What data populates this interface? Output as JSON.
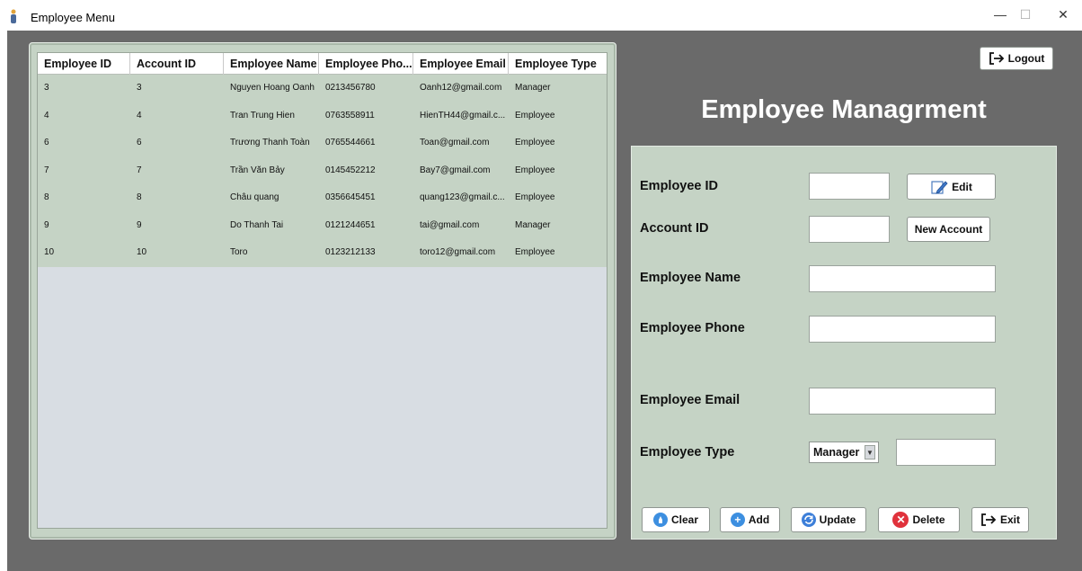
{
  "window": {
    "title": "Employee Menu",
    "minimize": "—",
    "maximize": "☐",
    "close": "✕"
  },
  "table": {
    "headers": [
      "Employee ID",
      "Account ID",
      "Employee Name",
      "Employee Pho...",
      "Employee Email",
      "Employee Type"
    ],
    "rows": [
      [
        "3",
        "3",
        "Nguyen Hoang Oanh",
        "0213456780",
        "Oanh12@gmail.com",
        "Manager"
      ],
      [
        "4",
        "4",
        "Tran Trung Hien",
        "0763558911",
        "HienTH44@gmail.c...",
        "Employee"
      ],
      [
        "6",
        "6",
        "Trương Thanh Toàn",
        "0765544661",
        "Toan@gmail.com",
        "Employee"
      ],
      [
        "7",
        "7",
        "Trần Văn Bảy",
        "0145452212",
        "Bay7@gmail.com",
        "Employee"
      ],
      [
        "8",
        "8",
        "Châu quang",
        "0356645451",
        "quang123@gmail.c...",
        "Employee"
      ],
      [
        "9",
        "9",
        "Do Thanh Tai",
        "0121244651",
        "tai@gmail.com",
        "Manager"
      ],
      [
        "10",
        "10",
        "Toro",
        "0123212133",
        "toro12@gmail.com",
        "Employee"
      ]
    ]
  },
  "header": {
    "title": "Employee Managrment",
    "logout_label": "Logout"
  },
  "form": {
    "employee_id_label": "Employee ID",
    "account_id_label": "Account ID",
    "employee_name_label": "Employee Name",
    "employee_phone_label": "Employee Phone",
    "employee_email_label": "Employee Email",
    "employee_type_label": "Employee Type",
    "employee_type_selected": "Manager",
    "edit_label": "Edit",
    "new_account_label": "New Account"
  },
  "actions": {
    "clear_label": "Clear",
    "add_label": "Add",
    "update_label": "Update",
    "delete_label": "Delete",
    "exit_label": "Exit"
  },
  "colors": {
    "panel_green": "#c5d3c5",
    "frame_gray": "#6a6a6a",
    "clear_icon": "#3d8fe0",
    "add_icon": "#3d8fe0",
    "update_icon": "#3d7fd9",
    "delete_icon": "#e0323c"
  }
}
